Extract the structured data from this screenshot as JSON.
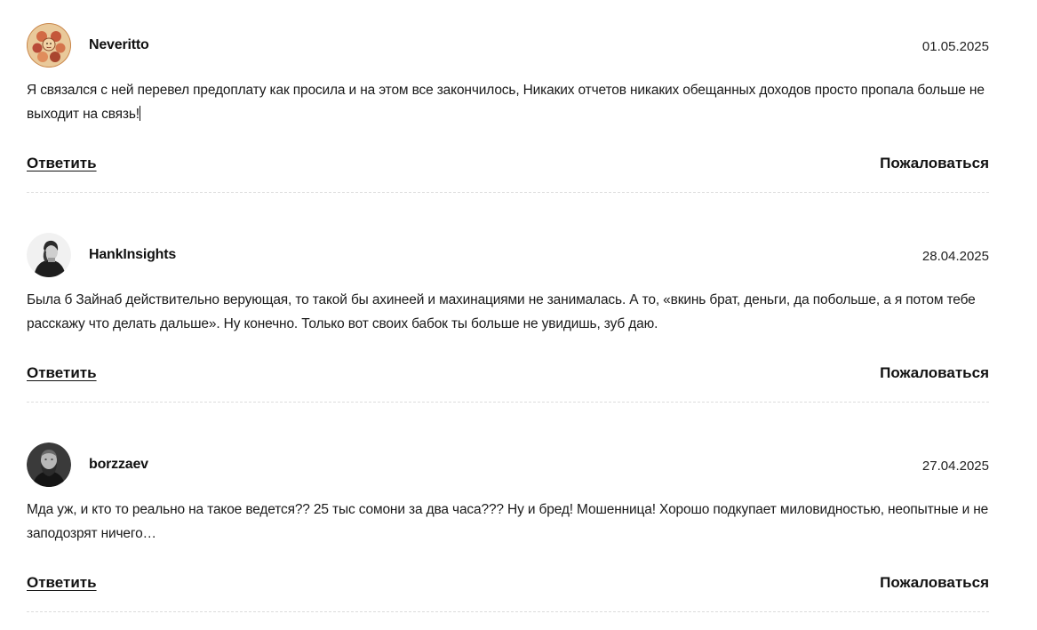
{
  "comments": [
    {
      "author": "Neveritto",
      "date": "01.05.2025",
      "avatar_icon": "painted-faces-avatar",
      "text": "Я связался с ней перевел предоплату как просила и на этом все закончилось, Никаких отчетов никаких обещанных доходов просто пропала больше не выходит на связь!",
      "reply_label": "Ответить",
      "report_label": "Пожаловаться"
    },
    {
      "author": "HankInsights",
      "date": "28.04.2025",
      "avatar_icon": "bw-portrait-avatar",
      "text": "Была б Зайнаб действительно верующая, то такой бы ахинеей и махинациями не занималась. А то, «вкинь брат, деньги, да побольше, а я потом тебе расскажу что делать дальше». Ну конечно. Только вот своих бабок ты больше не увидишь, зуб даю.",
      "reply_label": "Ответить",
      "report_label": "Пожаловаться"
    },
    {
      "author": "borzzaev",
      "date": "27.04.2025",
      "avatar_icon": "bearded-man-avatar",
      "text": "Мда уж, и кто то реально на такое ведется?? 25 тыс сомони за два часа??? Ну и бред! Мошенница! Хорошо подкупает миловидностью, неопытные и не заподозрят ничего…",
      "reply_label": "Ответить",
      "report_label": "Пожаловаться"
    }
  ],
  "colors": {
    "text": "#1a1a1a",
    "divider": "#dcdcdc",
    "background": "#ffffff"
  }
}
